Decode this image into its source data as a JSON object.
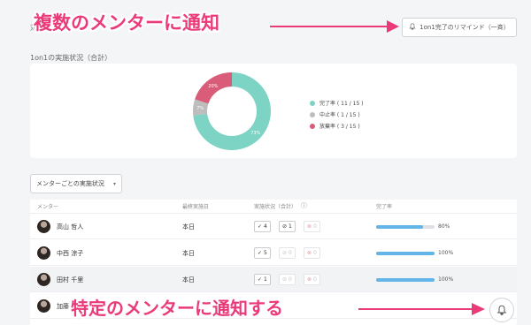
{
  "header": {
    "top_label": "対",
    "remind_button": "1on1完了のリマインド（一斉）",
    "remind_icon": "bell-icon"
  },
  "summary": {
    "title": "1on1の実施状況（合計）"
  },
  "chart_data": {
    "type": "pie",
    "donut": true,
    "categories": [
      "完了率 ( 11 / 15 )",
      "中止率 ( 1 / 15 )",
      "放棄率 ( 3 / 15 )"
    ],
    "values": [
      11,
      1,
      3
    ],
    "colors": [
      "#7dd3c4",
      "#bdbdbd",
      "#d95c78"
    ],
    "slice_labels": [
      "73%",
      "7%",
      "20%"
    ],
    "legend_position": "right"
  },
  "filter": {
    "dropdown_label": "メンターごとの実施状況",
    "caret_icon": "chevron-down-icon"
  },
  "table": {
    "headers": [
      "メンター",
      "最終実施日",
      "実施状況（合計）",
      "完了率"
    ],
    "help_icon": "question-circle-icon",
    "rows": [
      {
        "name": "高山 哲人",
        "last": "本日",
        "done": "4",
        "stop": "1",
        "skip": "0",
        "rate": 0.8,
        "rate_label": "80%"
      },
      {
        "name": "中西 涼子",
        "last": "本日",
        "done": "5",
        "stop": "0",
        "skip": "0",
        "rate": 1.0,
        "rate_label": "100%"
      },
      {
        "name": "田村 千里",
        "last": "本日",
        "done": "1",
        "stop": "0",
        "skip": "0",
        "rate": 1.0,
        "rate_label": "100%"
      },
      {
        "name": "加藤",
        "last": "",
        "done": "",
        "stop": "",
        "skip": "",
        "rate": 0,
        "rate_label": ""
      }
    ]
  },
  "annotations": {
    "top": "複数のメンターに通知",
    "bottom": "特定のメンターに通知する"
  },
  "bell_button_icon": "bell-icon"
}
